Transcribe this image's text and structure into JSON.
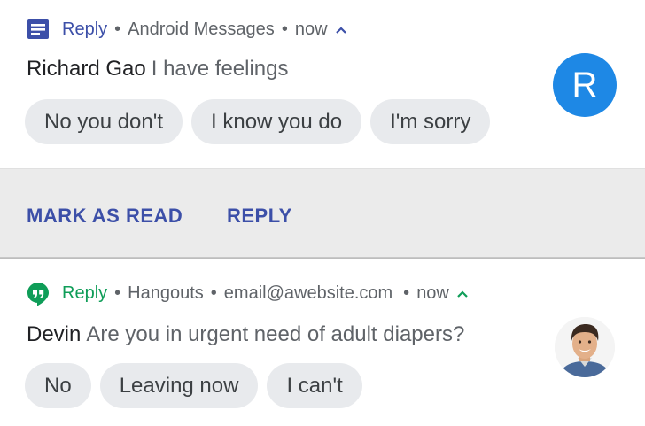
{
  "notifications": [
    {
      "header": {
        "action_label": "Reply",
        "separator1": "•",
        "app_name": "Android Messages",
        "separator2": "•",
        "time": "now",
        "expand_icon": "chevron-up-icon"
      },
      "sender": "Richard Gao",
      "message": "I have feelings",
      "avatar_letter": "R",
      "avatar_color": "#1e88e5",
      "smart_replies": [
        "No you don't",
        "I know you do",
        "I'm sorry"
      ],
      "actions": [
        "MARK AS READ",
        "REPLY"
      ],
      "accent_color": "#3c4fa8"
    },
    {
      "header": {
        "action_label": "Reply",
        "separator1": "•",
        "app_name": "Hangouts",
        "separator2": "•",
        "account": "email@awebsite.com",
        "separator3": "•",
        "time": "now",
        "expand_icon": "chevron-up-icon"
      },
      "sender": "Devin",
      "message": "Are you in urgent need of adult diapers?",
      "smart_replies": [
        "No",
        "Leaving now",
        "I can't"
      ],
      "accent_color": "#0f9d58"
    }
  ]
}
